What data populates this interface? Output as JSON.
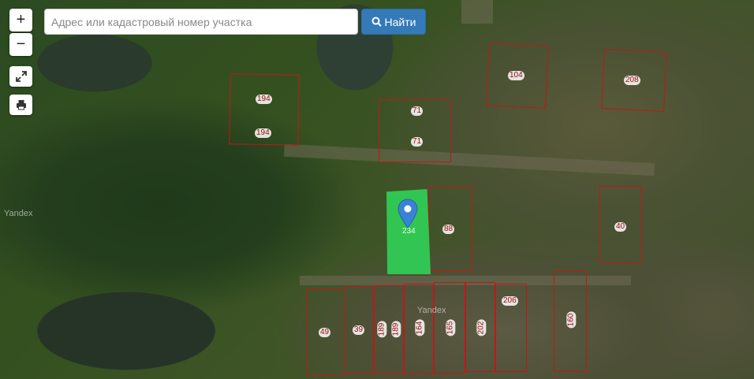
{
  "search": {
    "placeholder": "Адрес или кадастровый номер участка",
    "value": "",
    "button_label": "Найти",
    "button_icon": "search-icon"
  },
  "controls": {
    "zoom_in": "+",
    "zoom_out": "−",
    "fullscreen_icon": "expand-icon",
    "print_icon": "print-icon"
  },
  "map": {
    "watermark": "Yandex",
    "selected_parcel_label": "234",
    "parcel_color": "#c01818",
    "highlight_color": "#2fd95a",
    "marker_color": "#3a82d6",
    "parcels": [
      "194",
      "194",
      "71",
      "71",
      "104",
      "208",
      "88",
      "40",
      "49",
      "39",
      "189",
      "189",
      "164",
      "165",
      "202",
      "206",
      "160"
    ]
  }
}
